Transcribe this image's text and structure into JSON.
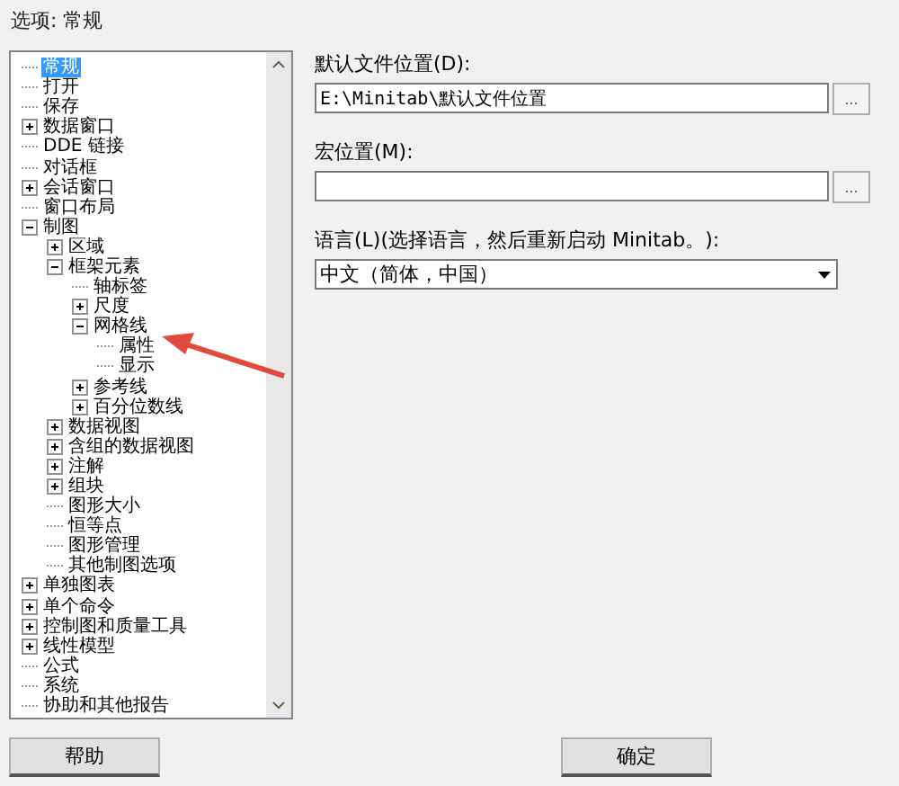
{
  "window": {
    "title": "选项: 常规"
  },
  "tree": [
    {
      "label": "常规",
      "selected": true
    },
    {
      "label": "打开",
      "selected": false
    },
    {
      "label": "保存",
      "selected": false
    },
    {
      "label": "数据窗口",
      "selected": false,
      "expanded": false
    },
    {
      "label": "DDE 链接",
      "selected": false
    },
    {
      "label": "对话框",
      "selected": false
    },
    {
      "label": "会话窗口",
      "selected": false,
      "expanded": false
    },
    {
      "label": "窗口布局",
      "selected": false
    },
    {
      "label": "制图",
      "selected": false,
      "expanded": true,
      "children": [
        {
          "label": "区域",
          "selected": false,
          "expanded": false
        },
        {
          "label": "框架元素",
          "selected": false,
          "expanded": true,
          "children": [
            {
              "label": "轴标签",
              "selected": false
            },
            {
              "label": "尺度",
              "selected": false,
              "expanded": false
            },
            {
              "label": "网格线",
              "selected": false,
              "expanded": true,
              "children": [
                {
                  "label": "属性",
                  "selected": false
                },
                {
                  "label": "显示",
                  "selected": false
                }
              ]
            },
            {
              "label": "参考线",
              "selected": false,
              "expanded": false
            },
            {
              "label": "百分位数线",
              "selected": false,
              "expanded": false
            }
          ]
        },
        {
          "label": "数据视图",
          "selected": false,
          "expanded": false
        },
        {
          "label": "含组的数据视图",
          "selected": false,
          "expanded": false
        },
        {
          "label": "注解",
          "selected": false,
          "expanded": false
        },
        {
          "label": "组块",
          "selected": false,
          "expanded": false
        },
        {
          "label": "图形大小",
          "selected": false
        },
        {
          "label": "恒等点",
          "selected": false
        },
        {
          "label": "图形管理",
          "selected": false
        },
        {
          "label": "其他制图选项",
          "selected": false
        }
      ]
    },
    {
      "label": "单独图表",
      "selected": false,
      "expanded": false
    },
    {
      "label": "单个命令",
      "selected": false,
      "expanded": false
    },
    {
      "label": "控制图和质量工具",
      "selected": false,
      "expanded": false
    },
    {
      "label": "线性模型",
      "selected": false,
      "expanded": false
    },
    {
      "label": "公式",
      "selected": false
    },
    {
      "label": "系统",
      "selected": false
    },
    {
      "label": "协助和其他报告",
      "selected": false
    }
  ],
  "default_file_location": {
    "label": "默认文件位置(D):",
    "value": "E:\\Minitab\\默认文件位置",
    "browse": "..."
  },
  "macro_location": {
    "label": "宏位置(M):",
    "browse": "..."
  },
  "language": {
    "label": "语言(L)(选择语言，然后重新启动 Minitab。):",
    "value": "中文（简体，中国）"
  },
  "buttons": {
    "help": "帮助",
    "ok": "确定"
  }
}
